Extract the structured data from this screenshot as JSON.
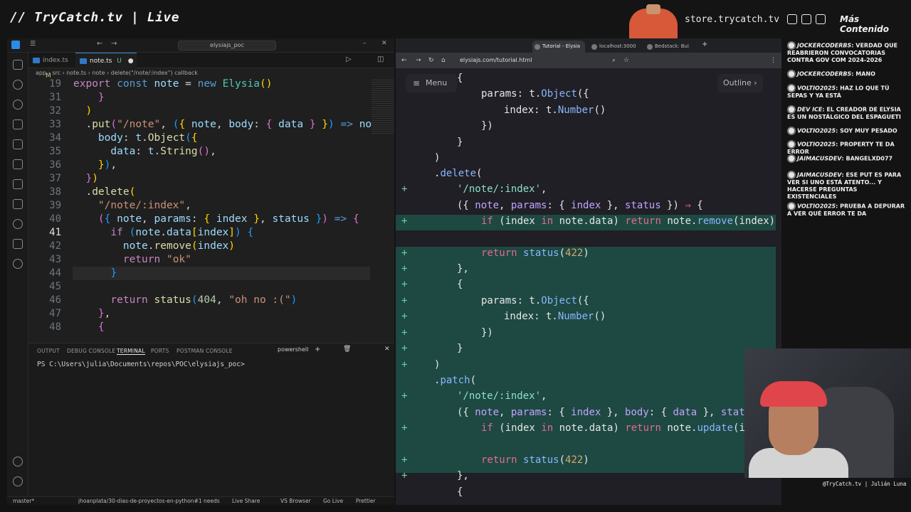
{
  "overlay": {
    "brand": "// TryCatch.tv | Live",
    "store": "store.trycatch.tv",
    "more": "Más Contenido",
    "handle": "@TryCatch.tv | Julián Luna"
  },
  "vscode": {
    "search": "elysiajs_poc",
    "tabs": [
      {
        "label": "index.ts",
        "badge": "M"
      },
      {
        "label": "note.ts",
        "badge": "U"
      }
    ],
    "breadcrumb": "app › src › note.ts › note › delete(\"/note/:index\") callback",
    "line_numbers": [
      "19",
      "31",
      "32",
      "33",
      "34",
      "35",
      "36",
      "37",
      "38",
      "39",
      "40",
      "41",
      "42",
      "43",
      "44",
      "45",
      "46",
      "47",
      "48"
    ],
    "current_line": "41",
    "panel_tabs": [
      "OUTPUT",
      "DEBUG CONSOLE",
      "TERMINAL",
      "PORTS",
      "POSTMAN CONSOLE"
    ],
    "terminal_shell": "powershell",
    "terminal_prompt": "PS C:\\Users\\julia\\Documents\\repos\\POC\\elysiajs_poc>",
    "status": {
      "branch": "master*",
      "pr": "jhoanplata/30-dias-de-proyectos-en-python#1 needs review",
      "live_share": "Live Share",
      "vs_browser": "VS Browser",
      "go_live": "Go Live",
      "prettier": "Prettier"
    }
  },
  "browser": {
    "tabs": [
      "Tutorial - Elysia",
      "localhost:3000",
      "Bedstack: Bui"
    ],
    "url": "elysiajs.com/tutorial.html",
    "menu": "Menu",
    "outline": "Outline"
  },
  "chat": [
    {
      "user": "JOCKERCODERBS",
      "text": "VERDAD QUE REABRIERON CONVOCATORIAS CONTRA GOV COM 2024-2026"
    },
    {
      "user": "JOCKERCODERBS",
      "text": "MANO"
    },
    {
      "user": "VOLTIO2025",
      "text": "HAZ LO QUE TÚ SEPAS Y YA ESTÁ"
    },
    {
      "user": "DEV ICE",
      "text": "EL CREADOR DE ELYSIA ES UN NOSTÁLGICO DEL ESPAGUETI"
    },
    {
      "user": "VOLTIO2025",
      "text": "SOY MUY PESADO"
    },
    {
      "user": "VOLTIO2025",
      "text": "PROPERTY TE DA ERROR"
    },
    {
      "user": "JAIMACUSDEV",
      "text": "BANGELXD077"
    },
    {
      "user": "JAIMACUSDEV",
      "text": "ESE PUT ES PARA VER SI UNO ESTÁ ATENTO... Y HACERSE PREGUNTAS EXISTENCIALES"
    },
    {
      "user": "VOLTIO2025",
      "text": "PRUEBA A DEPURAR A VER QUÉ ERROR TE DA"
    }
  ],
  "colors": {
    "vscode_bg": "#1f1f1f",
    "diff_add": "#1d4942",
    "accent": "#3e8ed0"
  }
}
